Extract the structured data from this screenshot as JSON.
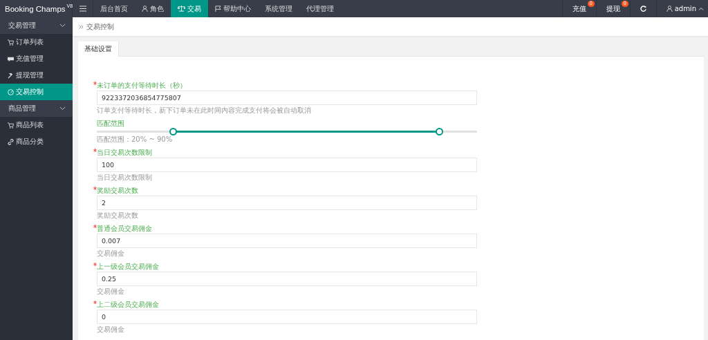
{
  "logo": {
    "name": "Booking Champs",
    "version": "V8"
  },
  "top_nav": [
    {
      "label": "后台首页",
      "selected": false
    },
    {
      "label": "角色",
      "selected": false
    },
    {
      "label": "交易",
      "selected": true
    },
    {
      "label": "帮助中心",
      "selected": false
    },
    {
      "label": "系统管理",
      "selected": false
    },
    {
      "label": "代理管理",
      "selected": false
    }
  ],
  "top_right": {
    "badges": [
      {
        "label": "充值",
        "count": "0"
      },
      {
        "label": "提现",
        "count": "0"
      }
    ],
    "user": "admin"
  },
  "sidebar": [
    {
      "label": "交易管理",
      "expanded": true,
      "children": [
        {
          "label": "订单列表",
          "selected": false
        },
        {
          "label": "充值管理",
          "selected": false
        },
        {
          "label": "提现管理",
          "selected": false
        },
        {
          "label": "交易控制",
          "selected": true
        }
      ]
    },
    {
      "label": "商品管理",
      "expanded": true,
      "children": [
        {
          "label": "商品列表",
          "selected": false
        },
        {
          "label": "商品分类",
          "selected": false
        }
      ]
    }
  ],
  "breadcrumb": "交易控制",
  "tabs": [
    {
      "label": "基础设置",
      "selected": true
    }
  ],
  "fields": [
    {
      "kind": "input",
      "label": "未订单的支付等待时长（秒）",
      "required": true,
      "value": "9223372036854775807",
      "hint": "订单支付等待时长，新下订单未在此时间内容完成支付将会被自动取消"
    },
    {
      "kind": "range",
      "label": "匹配范围",
      "low": {
        "level": 0.2
      },
      "high": {
        "level": 0.9
      },
      "hint": "匹配范围：20% ~ 90%"
    },
    {
      "kind": "input",
      "label": "当日交易次数限制",
      "required": true,
      "value": "100",
      "hint": "当日交易次数限制"
    },
    {
      "kind": "input",
      "label": "奖励交易次数",
      "required": true,
      "value": "2",
      "hint": "奖励交易次数"
    },
    {
      "kind": "input",
      "label": "普通会员交易佣金",
      "required": true,
      "value": "0.007",
      "hint": "交易佣金"
    },
    {
      "kind": "input",
      "label": "上一级会员交易佣金",
      "required": true,
      "value": "0.25",
      "hint": "交易佣金"
    },
    {
      "kind": "input",
      "label": "上二级会员交易佣金",
      "required": true,
      "value": "0",
      "hint": "交易佣金"
    }
  ]
}
